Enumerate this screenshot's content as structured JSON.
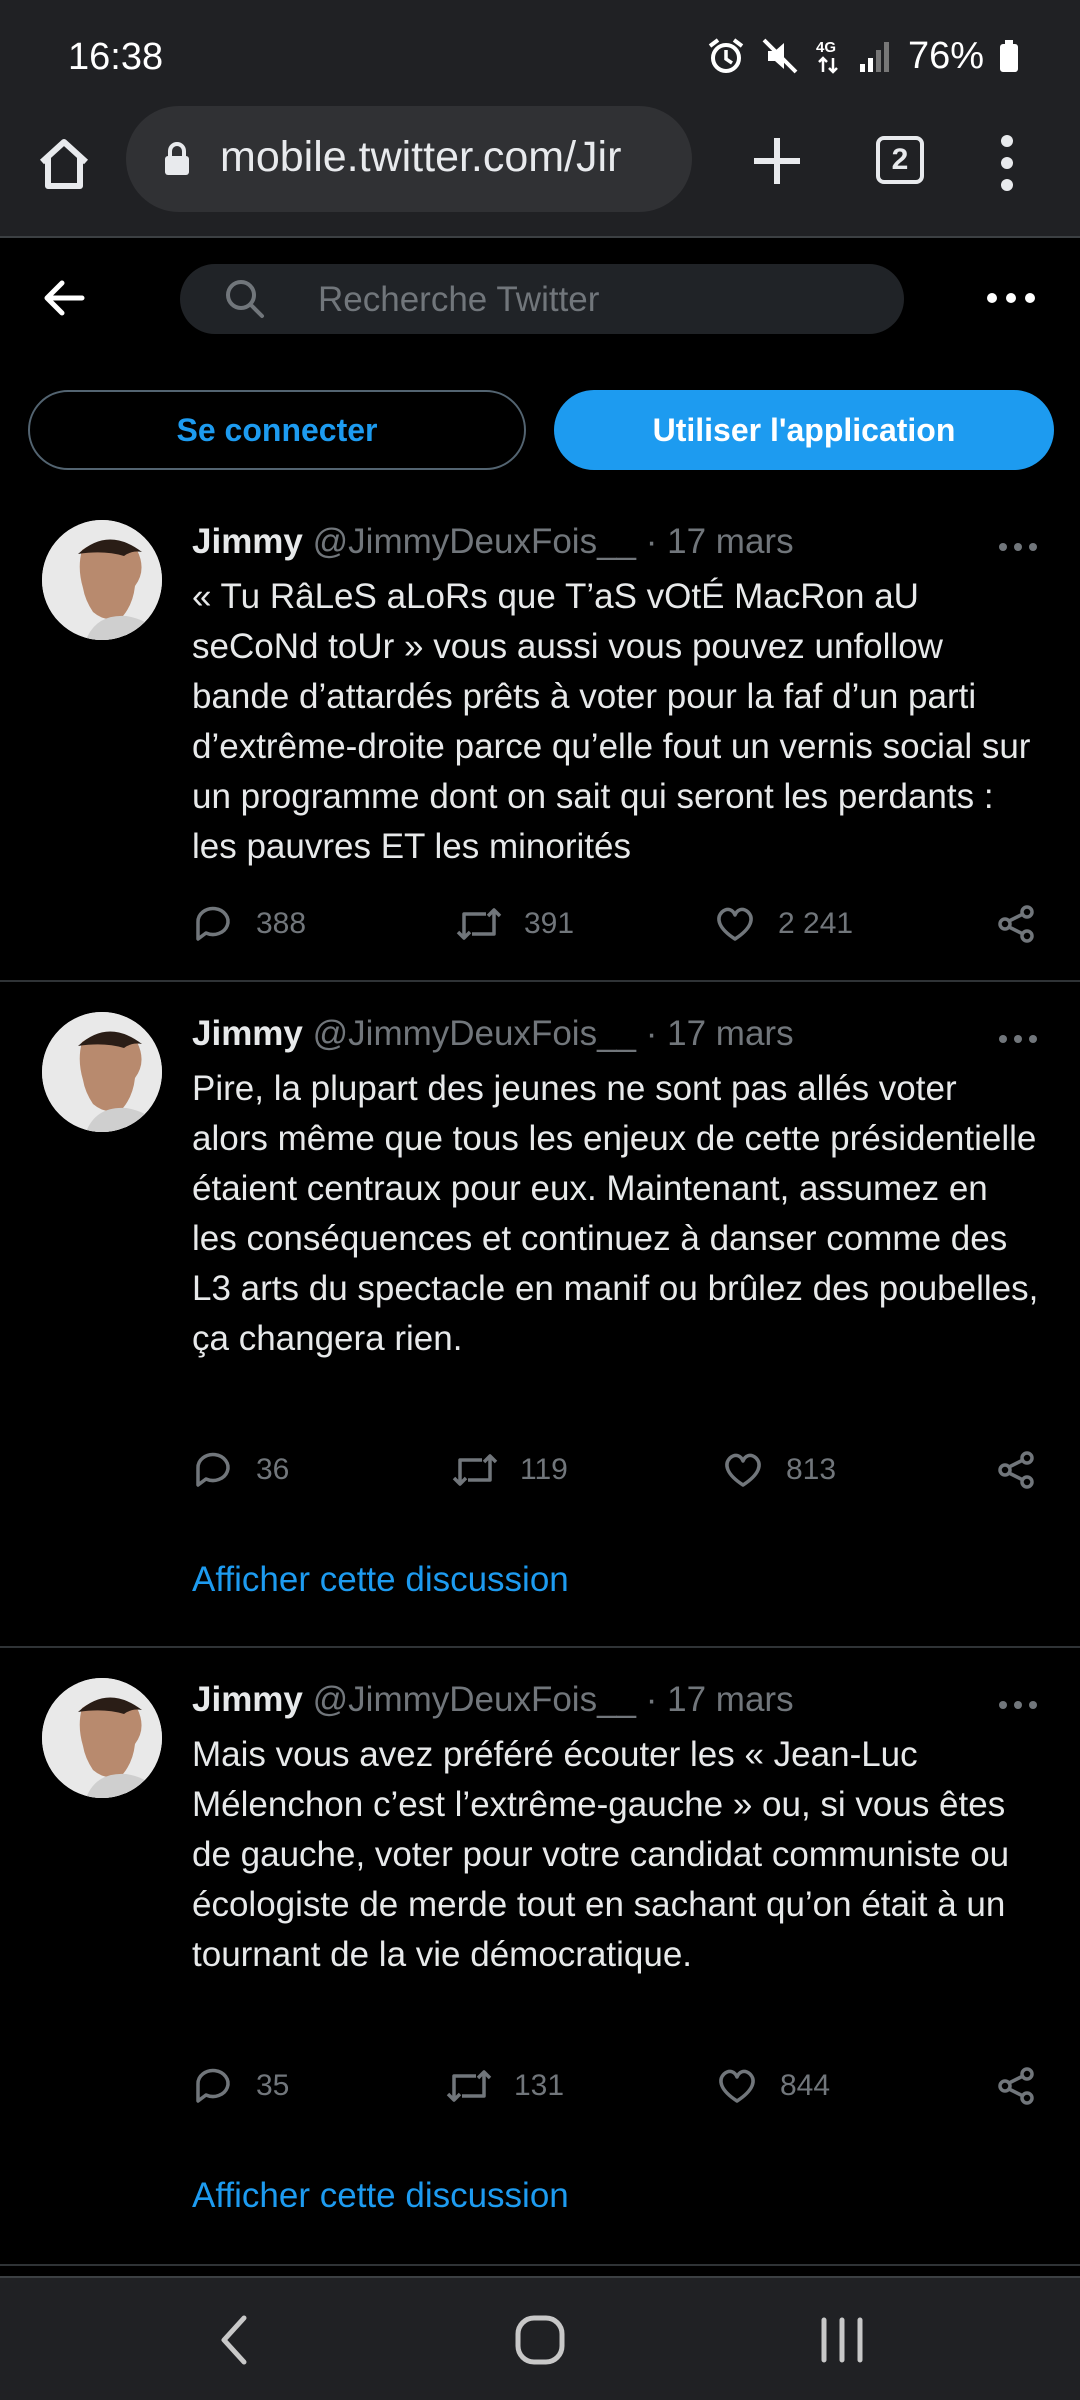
{
  "status_bar": {
    "time": "16:38",
    "network": "4G",
    "battery": "76%"
  },
  "browser": {
    "url": "mobile.twitter.com/Jir",
    "tab_count": "2"
  },
  "header": {
    "search_placeholder": "Recherche Twitter"
  },
  "buttons": {
    "login": "Se connecter",
    "app": "Utiliser l'application"
  },
  "tweets": [
    {
      "name": "Jimmy",
      "handle": "@JimmyDeuxFois__",
      "separator": "·",
      "date": "17 mars",
      "text": "« Tu RâLeS aLoRs que T’aS vOtÉ MacRon aU seCoNd toUr » vous aussi vous pouvez unfollow bande d’attardés prêts à voter pour la faf d’un parti d’extrême-droite parce qu’elle fout un vernis social sur un programme dont on sait qui seront les perdants : les pauvres ET les minorités",
      "replies": "388",
      "retweets": "391",
      "likes": "2 241"
    },
    {
      "name": "Jimmy",
      "handle": "@JimmyDeuxFois__",
      "separator": "·",
      "date": "17 mars",
      "text": "Pire, la plupart des jeunes ne sont pas allés voter alors même que tous les enjeux de cette présidentielle étaient centraux pour eux. Maintenant, assumez en les conséquences et continuez à danser comme des L3 arts du spectacle en manif ou brûlez des poubelles, ça changera rien.",
      "replies": "36",
      "retweets": "119",
      "likes": "813",
      "thread_link": "Afficher cette discussion"
    },
    {
      "name": "Jimmy",
      "handle": "@JimmyDeuxFois__",
      "separator": "·",
      "date": "17 mars",
      "text": "Mais vous avez préféré écouter les « Jean-Luc Mélenchon c’est l’extrême-gauche » ou, si vous êtes de gauche, voter pour votre candidat communiste ou écologiste de merde tout en sachant qu’on était à un tournant de la vie démocratique.",
      "replies": "35",
      "retweets": "131",
      "likes": "844",
      "thread_link": "Afficher cette discussion"
    }
  ],
  "colors": {
    "accent": "#1d9bf0",
    "background": "#000000",
    "muted": "#71767b",
    "text": "#e7e9ea",
    "chrome": "#202124"
  }
}
